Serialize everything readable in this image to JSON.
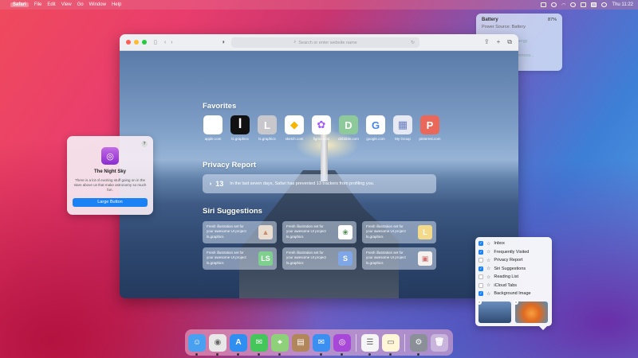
{
  "menubar": {
    "apple": "",
    "items": [
      "Safari",
      "File",
      "Edit",
      "View",
      "Go",
      "Window",
      "Help"
    ],
    "clock": "Thu 11:22"
  },
  "battery": {
    "title": "Battery",
    "percent": "87%",
    "power_source": "Power Source: Battery",
    "energy": "Energy",
    "more": "ferences..."
  },
  "safari": {
    "address_placeholder": "Search or enter website name",
    "favorites_title": "Favorites",
    "favorites": [
      {
        "label": "apple.com",
        "glyph": "",
        "bg": "#ffffff",
        "fg": "#888888"
      },
      {
        "label": "ls.graphics",
        "glyph": "ꟾ",
        "bg": "#111111",
        "fg": "#ffffff"
      },
      {
        "label": "ls.graphics",
        "glyph": "L",
        "bg": "#c8c8cc",
        "fg": "#ffffff"
      },
      {
        "label": "sketch.com",
        "glyph": "◆",
        "bg": "#ffffff",
        "fg": "#f7b500"
      },
      {
        "label": "figma.com",
        "glyph": "✿",
        "bg": "#ffffff",
        "fg": "#a259ff"
      },
      {
        "label": "dribbble.com",
        "glyph": "D",
        "bg": "#8ec99a",
        "fg": "#ffffff"
      },
      {
        "label": "google.com",
        "glyph": "G",
        "bg": "#ffffff",
        "fg": "#4285f4"
      },
      {
        "label": "My Group",
        "glyph": "▦",
        "bg": "#e6e9f2",
        "fg": "#6b7fc0"
      },
      {
        "label": "pinterest.com",
        "glyph": "P",
        "bg": "#e9685a",
        "fg": "#ffffff"
      }
    ],
    "privacy_title": "Privacy Report",
    "privacy_count": "13",
    "privacy_text": "In the last seven days, Safari has prevented 13 trackers from profiling you.",
    "siri_title": "Siri Suggestions",
    "siri_cards": [
      {
        "line1": "Fresh illustration set for",
        "line2": "your awesome UI project",
        "site": "ls.graphics",
        "thumb": "▲",
        "thumb_bg": "#e8ddd0",
        "thumb_fg": "#c98c6a"
      },
      {
        "line1": "Fresh illustration set for",
        "line2": "your awesome UI project",
        "site": "ls.graphics",
        "thumb": "❀",
        "thumb_bg": "#ffffff",
        "thumb_fg": "#4a8a4a"
      },
      {
        "line1": "Fresh illustration set for",
        "line2": "your awesome UI project",
        "site": "ls.graphics",
        "thumb": "L",
        "thumb_bg": "#f3d98a",
        "thumb_fg": "#ffffff"
      },
      {
        "line1": "Fresh illustration set for",
        "line2": "your awesome UI project",
        "site": "ls.graphics",
        "thumb": "LS",
        "thumb_bg": "#7fcf8e",
        "thumb_fg": "#ffffff"
      },
      {
        "line1": "Fresh illustration set for",
        "line2": "your awesome UI project",
        "site": "ls.graphics",
        "thumb": "S",
        "thumb_bg": "#7fa6e6",
        "thumb_fg": "#ffffff"
      },
      {
        "line1": "Fresh illustration set for",
        "line2": "your awesome UI project",
        "site": "ls.graphics",
        "thumb": "▣",
        "thumb_bg": "#f4f0ee",
        "thumb_fg": "#d07070"
      }
    ]
  },
  "nightsky": {
    "help": "?",
    "title": "The Night Sky",
    "body": "There is a lot of exciting stuff going on in the stars above us that make astronomy so much fun.",
    "button": "Large Button"
  },
  "checklist": {
    "items": [
      {
        "label": "Inbox",
        "checked": true
      },
      {
        "label": "Frequently Visited",
        "checked": true
      },
      {
        "label": "Privacy Report",
        "checked": false
      },
      {
        "label": "Siri Suggestions",
        "checked": true
      },
      {
        "label": "Reading List",
        "checked": false
      },
      {
        "label": "iCloud Tabs",
        "checked": false
      },
      {
        "label": "Background Image",
        "checked": true
      }
    ]
  },
  "dock": {
    "apps": [
      {
        "name": "finder",
        "glyph": "☺",
        "bg": "#4aa0f0"
      },
      {
        "name": "chrome",
        "glyph": "◉",
        "bg": "#e8e8e8"
      },
      {
        "name": "app-store",
        "glyph": "A",
        "bg": "#2f8ff0"
      },
      {
        "name": "messages",
        "glyph": "✉",
        "bg": "#45c65a"
      },
      {
        "name": "maps",
        "glyph": "⌖",
        "bg": "#8fd07a"
      },
      {
        "name": "notes-brown",
        "glyph": "▤",
        "bg": "#b0865a"
      },
      {
        "name": "mail",
        "glyph": "✉",
        "bg": "#3b8ff0"
      },
      {
        "name": "podcasts",
        "glyph": "◎",
        "bg": "#a848d8"
      },
      {
        "name": "reminders",
        "glyph": "☰",
        "bg": "#f5f5f5"
      },
      {
        "name": "notes",
        "glyph": "▭",
        "bg": "#fff6d8"
      },
      {
        "name": "system-preferences",
        "glyph": "⚙",
        "bg": "#8a8f98"
      },
      {
        "name": "trash",
        "glyph": "🗑",
        "bg": "rgba(255,255,255,0.35)"
      }
    ]
  }
}
